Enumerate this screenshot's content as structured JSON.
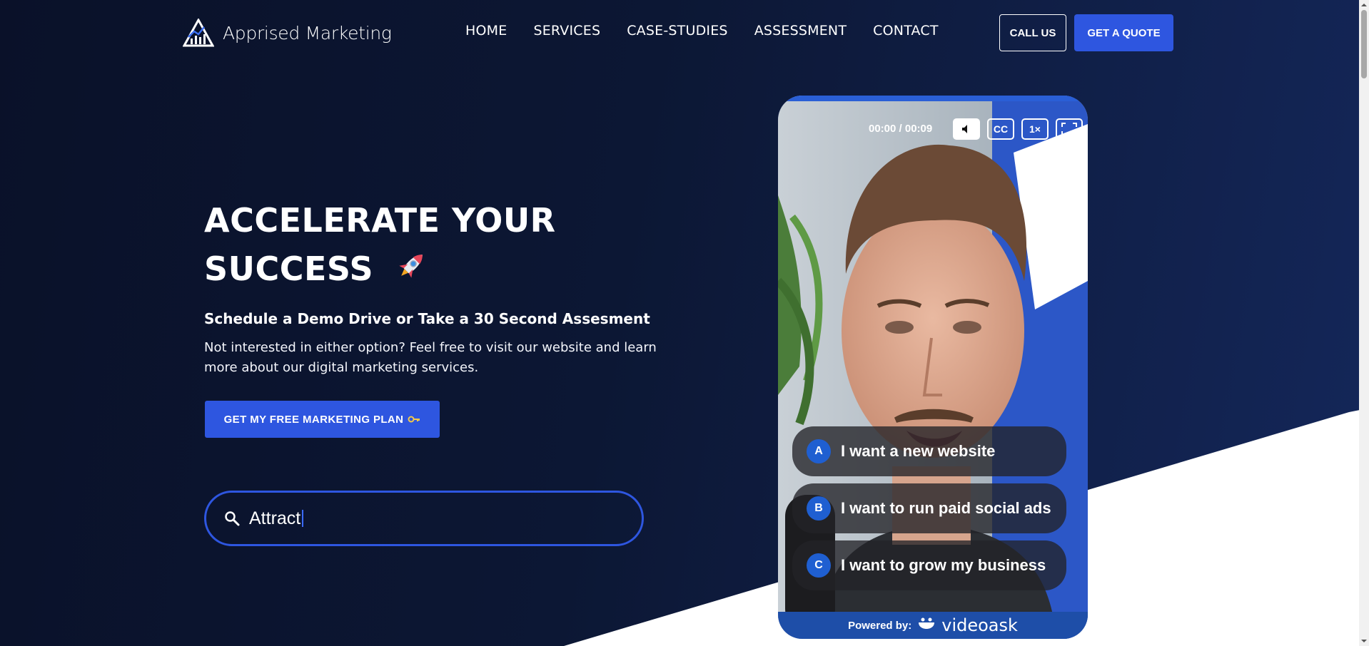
{
  "brand": {
    "name": "Apprised Marketing",
    "logo_icon": "mountain-chart-logo"
  },
  "nav": {
    "items": [
      {
        "label": "HOME"
      },
      {
        "label": "SERVICES"
      },
      {
        "label": "CASE-STUDIES"
      },
      {
        "label": "ASSESSMENT"
      },
      {
        "label": "CONTACT"
      }
    ],
    "call_label": "CALL US",
    "quote_label": "GET A QUOTE"
  },
  "hero": {
    "title_line1": "ACCELERATE YOUR",
    "title_line2": "SUCCESS",
    "title_icon": "rocket-icon",
    "subtitle": "Schedule a Demo Drive or Take a 30 Second Assesment",
    "description": "Not interested in either option? Feel free to visit our website and learn more about our digital marketing services.",
    "cta_label": "GET MY FREE MARKETING PLAN",
    "cta_icon": "key-icon"
  },
  "search": {
    "value": "Attract"
  },
  "video": {
    "time": "00:00 / 00:09",
    "captions_label": "CC",
    "speed_label": "1×",
    "options": [
      {
        "letter": "A",
        "text": "I want a new website"
      },
      {
        "letter": "B",
        "text": "I want to run paid social ads"
      },
      {
        "letter": "C",
        "text": "I want to grow my business"
      }
    ],
    "powered_label": "Powered by:",
    "powered_brand": "videoask"
  },
  "colors": {
    "background": "#0b1430",
    "accent": "#2e56e0",
    "video_blue": "#1e4ea8"
  }
}
